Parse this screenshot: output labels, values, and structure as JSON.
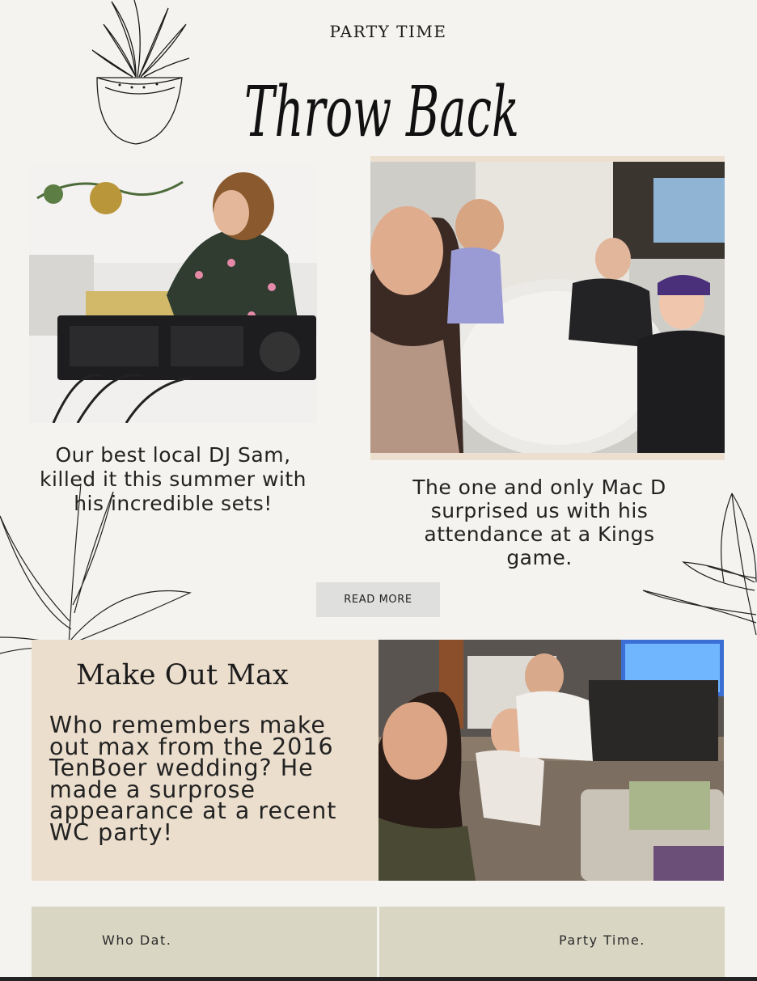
{
  "header": {
    "kicker": "PARTY TIME",
    "title": "Throw Back"
  },
  "cards": [
    {
      "caption": "Our best local DJ Sam, killed it this summer with his incredible sets!",
      "photo_icon": "dj-photo"
    },
    {
      "caption": "The one and only Mac D surprised us with his attendance at a Kings game.",
      "photo_icon": "restaurant-selfie-photo"
    }
  ],
  "read_more_label": "READ MORE",
  "feature": {
    "title": "Make Out Max",
    "body": "Who remembers make out max from the 2016 TenBoer wedding? He made a surprose appearance at a recent WC party!",
    "photo_icon": "living-room-selfie-photo"
  },
  "footer": {
    "left_label": "Who Dat.",
    "right_label": "Party Time."
  },
  "colors": {
    "background": "#f4f3ef",
    "feature_panel": "#ebdecd",
    "footer_panel": "#d9d6c4",
    "button": "#dfe0dd"
  }
}
